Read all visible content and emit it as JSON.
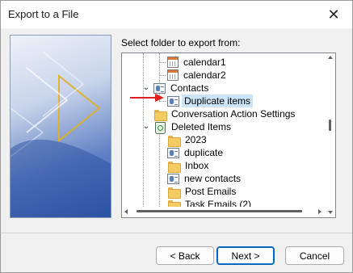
{
  "window": {
    "title": "Export to a File",
    "close_glyph": "✕"
  },
  "prompt": "Select folder to export from:",
  "tree": {
    "items": [
      {
        "label": "calendar1",
        "icon": "calendar-icon"
      },
      {
        "label": "calendar2",
        "icon": "calendar-icon"
      },
      {
        "label": "Contacts",
        "icon": "contacts-icon",
        "expanded": true
      },
      {
        "label": "Duplicate items",
        "icon": "contacts-icon",
        "selected": true
      },
      {
        "label": "Conversation Action Settings",
        "icon": "folder-icon"
      },
      {
        "label": "Deleted Items",
        "icon": "deleted-items-icon",
        "expanded": true
      },
      {
        "label": "2023",
        "icon": "folder-icon"
      },
      {
        "label": "duplicate",
        "icon": "contacts-icon"
      },
      {
        "label": "Inbox",
        "icon": "folder-icon"
      },
      {
        "label": "new contacts",
        "icon": "contacts-icon"
      },
      {
        "label": "Post Emails",
        "icon": "folder-icon"
      },
      {
        "label": "Task Emails (2)",
        "icon": "folder-icon"
      }
    ]
  },
  "buttons": {
    "back": "< Back",
    "next": "Next >",
    "cancel": "Cancel"
  },
  "colors": {
    "selection": "#cce4f7",
    "annotation_arrow": "#e02020",
    "default_button_border": "#0067c0"
  }
}
